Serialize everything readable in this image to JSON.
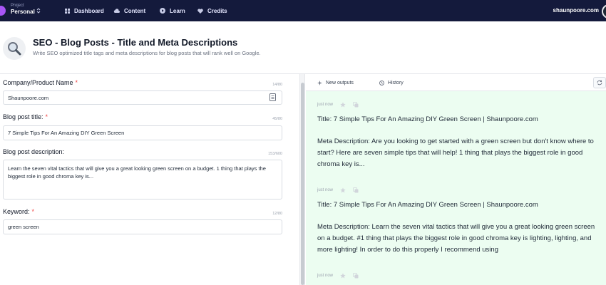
{
  "nav": {
    "project_label": "Project",
    "project_name": "Personal",
    "items": [
      {
        "label": "Dashboard",
        "icon": "grid-icon"
      },
      {
        "label": "Content",
        "icon": "cloud-icon"
      },
      {
        "label": "Learn",
        "icon": "play-circle-icon"
      },
      {
        "label": "Credits",
        "icon": "heart-icon"
      }
    ],
    "user": "shaunpoore.com"
  },
  "header": {
    "title": "SEO - Blog Posts - Title and Meta Descriptions",
    "description": "Write SEO optimized title tags and meta descriptions for blog posts that will rank well on Google."
  },
  "form": {
    "company": {
      "label": "Company/Product Name",
      "required": "*",
      "count": "14/80",
      "value": "Shaunpoore.com"
    },
    "title": {
      "label": "Blog post title:",
      "required": "*",
      "count": "45/80",
      "value": "7 Simple Tips For An Amazing DIY Green Screen"
    },
    "description": {
      "label": "Blog post description:",
      "count": "153/600",
      "value": "Learn the seven vital tactics that will give you a great looking green screen on a budget.   1 thing that plays the biggest role in good chroma key is..."
    },
    "keyword": {
      "label": "Keyword:",
      "required": "*",
      "count": "12/80",
      "value": "green screen"
    }
  },
  "tabs": {
    "new_outputs": "New outputs",
    "history": "History"
  },
  "outputs": [
    {
      "time": "just now",
      "title_line": "Title: 7 Simple Tips For An Amazing DIY Green Screen | Shaunpoore.com",
      "meta_line": "Meta Description: Are you looking to get started with a green screen but don't know where to start? Here are seven simple tips that will help!   1 thing that plays the biggest role in good chroma key is..."
    },
    {
      "time": "just now",
      "title_line": "Title: 7 Simple Tips For An Amazing DIY Green Screen | Shaunpoore.com",
      "meta_line": "Meta Description: Learn the seven vital tactics that will give you a great looking green screen on a budget.  #1 thing that plays the biggest role in good chroma key is lighting, lighting, and more lighting!  In order to do this properly I recommend using"
    },
    {
      "time": "just now"
    }
  ],
  "colors": {
    "nav_bg": "#141a3c",
    "accent": "#a855f7",
    "output_bg": "#ecfdf1",
    "required": "#ef4444"
  }
}
